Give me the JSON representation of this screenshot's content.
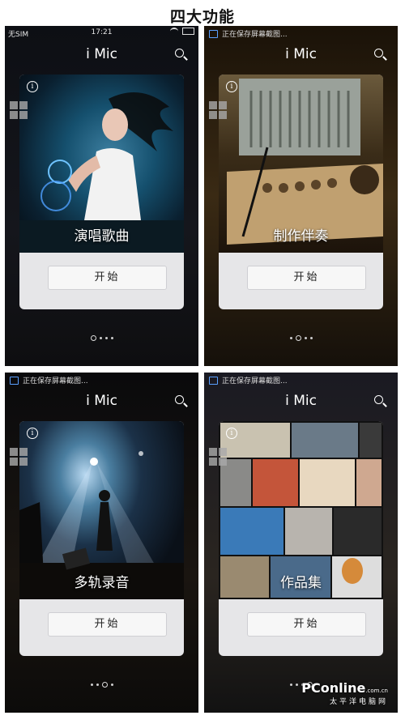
{
  "page_title": "四大功能",
  "status_bar": {
    "carrier": "无SIM",
    "time": "17:21"
  },
  "notification": "正在保存屏幕截图...",
  "app_title": "i Mic",
  "info_glyph": "i",
  "screens": [
    {
      "caption": "演唱歌曲",
      "button": "开始",
      "page_index": 1
    },
    {
      "caption": "制作伴奏",
      "button": "开始",
      "page_index": 2
    },
    {
      "caption": "多轨录音",
      "button": "开始",
      "page_index": 3
    },
    {
      "caption": "作品集",
      "button": "开始",
      "page_index": 4
    }
  ],
  "watermark": {
    "brand": "PConline",
    "sub": "太平洋电脑网",
    "domain": ".com.cn"
  },
  "colors": {
    "background": "#0b0b0d",
    "card": "#e6e6e8",
    "notif_icon": "#5aa0ff"
  }
}
